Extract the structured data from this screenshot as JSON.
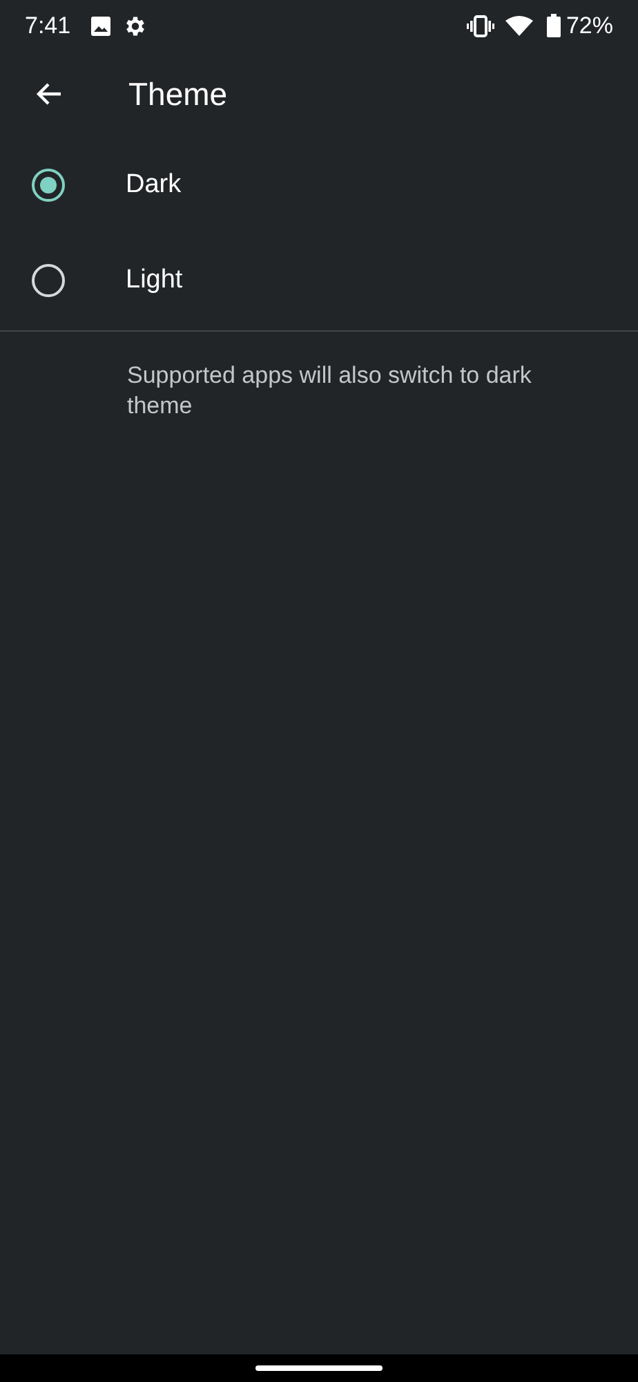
{
  "status_bar": {
    "time": "7:41",
    "battery": "72%"
  },
  "app_bar": {
    "title": "Theme"
  },
  "options": [
    {
      "label": "Dark",
      "selected": true
    },
    {
      "label": "Light",
      "selected": false
    }
  ],
  "footer_note": "Supported apps will also switch to dark theme"
}
